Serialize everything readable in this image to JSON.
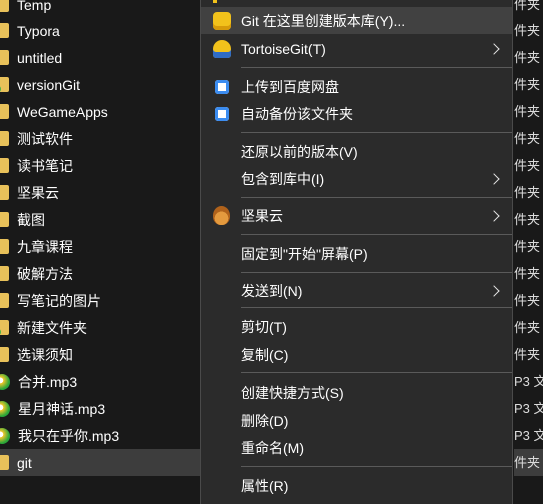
{
  "file_list": [
    {
      "name": "Temp",
      "icon": "folder-icon"
    },
    {
      "name": "Typora",
      "icon": "folder-icon"
    },
    {
      "name": "untitled",
      "icon": "folder-icon"
    },
    {
      "name": "versionGit",
      "icon": "folder-git-icon"
    },
    {
      "name": "WeGameApps",
      "icon": "folder-icon"
    },
    {
      "name": "测试软件",
      "icon": "folder-icon"
    },
    {
      "name": "读书笔记",
      "icon": "folder-icon"
    },
    {
      "name": "坚果云",
      "icon": "folder-icon"
    },
    {
      "name": "截图",
      "icon": "folder-icon"
    },
    {
      "name": "九章课程",
      "icon": "folder-icon"
    },
    {
      "name": "破解方法",
      "icon": "folder-icon"
    },
    {
      "name": "写笔记的图片",
      "icon": "folder-icon"
    },
    {
      "name": "新建文件夹",
      "icon": "folder-git-icon"
    },
    {
      "name": "选课须知",
      "icon": "folder-icon"
    },
    {
      "name": "合并.mp3",
      "icon": "audio-file-icon"
    },
    {
      "name": "星月神话.mp3",
      "icon": "audio-file-icon"
    },
    {
      "name": "我只在乎你.mp3",
      "icon": "audio-file-icon"
    },
    {
      "name": "git",
      "icon": "folder-icon",
      "selected": true
    }
  ],
  "type_column": [
    "件夹",
    "件夹",
    "件夹",
    "件夹",
    "件夹",
    "件夹",
    "件夹",
    "件夹",
    "件夹",
    "件夹",
    "件夹",
    "件夹",
    "件夹",
    "件夹",
    "P3 文",
    "P3 文",
    "P3 文",
    "件夹"
  ],
  "context_menu": {
    "items": {
      "git_create_repo": "Git 在这里创建版本库(Y)...",
      "tortoise_git": "TortoiseGit(T)",
      "upload_baidu": "上传到百度网盘",
      "auto_backup": "自动备份该文件夹",
      "restore_previous": "还原以前的版本(V)",
      "include_in_library": "包含到库中(I)",
      "jianguoyun": "坚果云",
      "pin_to_start": "固定到\"开始\"屏幕(P)",
      "send_to": "发送到(N)",
      "cut": "剪切(T)",
      "copy": "复制(C)",
      "create_shortcut": "创建快捷方式(S)",
      "delete": "删除(D)",
      "rename": "重命名(M)",
      "properties": "属性(R)"
    }
  },
  "colors": {
    "background": "#191919",
    "menu_background": "#2b2b2b",
    "hover": "#414141",
    "selected_row": "#3d3d3d",
    "folder": "#e8c15a"
  }
}
